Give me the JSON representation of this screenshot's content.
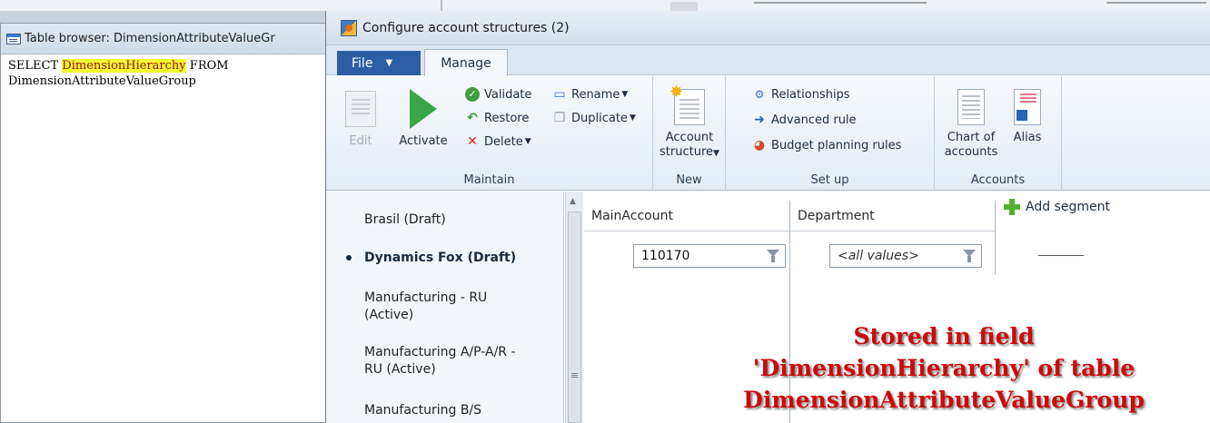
{
  "table_browser": {
    "title": "Table browser: DimensionAttributeValueGr",
    "sql_kw1": "SELECT",
    "sql_field": "DimensionHierarchy",
    "sql_kw2": "FROM",
    "sql_table": "DimensionAttributeValueGroup"
  },
  "configure": {
    "title": "Configure account structures (2)",
    "tabs": {
      "file": "File",
      "manage": "Manage"
    },
    "ribbon": {
      "maintain": {
        "label": "Maintain",
        "edit": "Edit",
        "activate": "Activate",
        "validate": "Validate",
        "restore": "Restore",
        "delete": "Delete",
        "rename": "Rename",
        "duplicate": "Duplicate"
      },
      "new": {
        "label": "New",
        "account_structure_line1": "Account",
        "account_structure_line2": "structure"
      },
      "setup": {
        "label": "Set up",
        "relationships": "Relationships",
        "advanced_rule": "Advanced rule",
        "budget_planning_rules": "Budget planning rules"
      },
      "accounts": {
        "label": "Accounts",
        "chart_line1": "Chart of",
        "chart_line2": "accounts",
        "alias": "Alias"
      }
    },
    "structures": [
      {
        "name": "Brasil (Draft)"
      },
      {
        "name": "Dynamics Fox (Draft)",
        "selected": true
      },
      {
        "name": "Manufacturing - RU (Active)"
      },
      {
        "name": "Manufacturing A/P-A/R - RU (Active)"
      },
      {
        "name": "Manufacturing B/S"
      }
    ],
    "grid": {
      "col1": "MainAccount",
      "col2": "Department",
      "mainaccount_value": "110170",
      "department_value": "<all values>",
      "add_segment": "Add segment"
    },
    "annotation": {
      "line1": "Stored in field",
      "line2": "'DimensionHierarchy' of table",
      "line3": "DimensionAttributeValueGroup"
    }
  },
  "colors": {
    "file_tab": "#2b5ea5",
    "annotation": "#cc0a0a",
    "highlight": "#f4ff31",
    "activate_green": "#3aa64a"
  }
}
